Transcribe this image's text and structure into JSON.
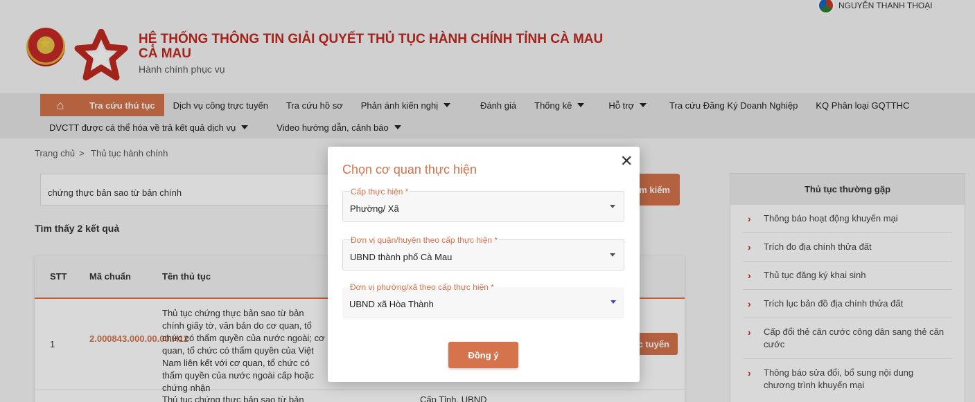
{
  "user": {
    "name": "NGUYỄN THANH THOẠI"
  },
  "site": {
    "title": "HỆ THỐNG THÔNG TIN GIẢI QUYẾT THỦ TỤC HÀNH CHÍNH TỈNH CÀ MAU",
    "title_line2": "CÀ MAU",
    "subtitle": "Hành chính phục vụ"
  },
  "nav": {
    "row1": [
      {
        "label": "Tra cứu thủ tục",
        "active": true
      },
      {
        "label": "Dịch vụ công trực tuyến"
      },
      {
        "label": "Tra cứu hồ sơ"
      },
      {
        "label": "Phản ánh kiến nghị",
        "dropdown": true
      },
      {
        "label": "Đánh giá"
      },
      {
        "label": "Thống kê",
        "dropdown": true
      },
      {
        "label": "Hỗ trợ",
        "dropdown": true
      },
      {
        "label": "Tra cứu Đăng Ký Doanh Nghiệp"
      },
      {
        "label": "KQ Phân loại GQTTHC"
      }
    ],
    "row2": [
      {
        "label": "DVCTT được cá thể hóa về trả kết quả dịch vụ",
        "dropdown": true
      },
      {
        "label": "Video hướng dẫn, cảnh báo",
        "dropdown": true
      }
    ]
  },
  "breadcrumb": {
    "home": "Trang chủ",
    "sep": ">",
    "current": "Thủ tục hành chính"
  },
  "search": {
    "value": "chứng thực bản sao từ bản chính",
    "button": "Tìm kiếm",
    "button_visible": "ìm kiếm"
  },
  "results": {
    "text": "Tìm thấy 2 kết quả"
  },
  "table": {
    "headers": [
      "STT",
      "Mã chuẩn",
      "Tên thủ tục"
    ],
    "rows": [
      {
        "stt": "1",
        "code": "2.000843.000.00.00.H12",
        "name": "Thủ tục chứng thực bản sao từ bản chính giấy tờ, văn bản do cơ quan, tổ chức có thẩm quyền của nước ngoài; cơ quan, tổ chức có thẩm quyền của Việt Nam liên kết với cơ quan, tổ chức có thẩm quyền của nước ngoài cấp hoặc chứng nhận",
        "action": "c tuyến"
      },
      {
        "name": "Thủ tục chứng thực bản sao từ bản chính",
        "level": "Cấp Tỉnh, UBND"
      }
    ]
  },
  "sidebar": {
    "title": "Thủ tục thường gặp",
    "items": [
      "Thông báo hoạt động khuyến mại",
      "Trích đo địa chính thửa đất",
      "Thủ tục đăng ký khai sinh",
      "Trích lục bản đồ địa chính thửa đất",
      "Cấp đổi thẻ căn cước công dân sang thẻ căn cước",
      "Thông báo sửa đổi, bổ sung nội dung chương trình khuyến mại"
    ]
  },
  "modal": {
    "title": "Chọn cơ quan thực hiện",
    "fields": [
      {
        "label": "Cấp thực hiện *",
        "value": "Phường/ Xã"
      },
      {
        "label": "Đơn vị quận/huyện theo cấp thực hiện *",
        "value": "UBND thành phố Cà Mau"
      },
      {
        "label": "Đơn vị phường/xã theo cấp thực hiện *",
        "value": "UBND xã Hòa Thành"
      }
    ],
    "confirm": "Đồng ý",
    "close_icon": "close-icon"
  },
  "colors": {
    "accent": "#d4734c",
    "brand_red": "#c0281f"
  }
}
